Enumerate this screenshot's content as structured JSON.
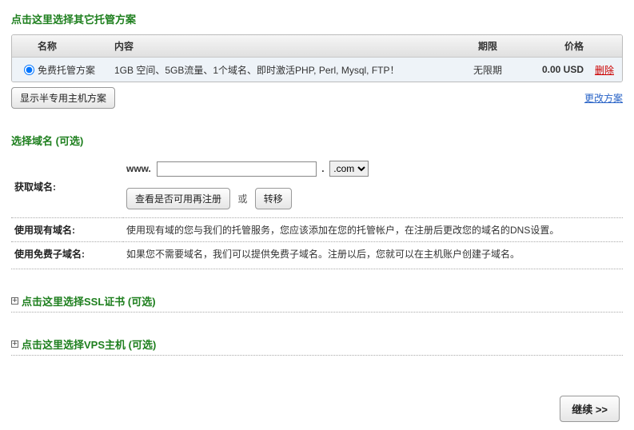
{
  "plans": {
    "section_title": "点击这里选择其它托管方案",
    "headers": {
      "name": "名称",
      "content": "内容",
      "term": "期限",
      "price": "价格"
    },
    "row": {
      "name": "免费托管方案",
      "content": "1GB 空间、5GB流量、1个域名、即时激活PHP, Perl, Mysql, FTP！",
      "term": "无限期",
      "price": "0.00 USD",
      "delete": "删除"
    },
    "show_semi": "显示半专用主机方案",
    "change_plan": "更改方案"
  },
  "domains": {
    "section_title": "选择域名 (可选)",
    "get_label": "获取域名:",
    "www": "www.",
    "tld": ".com",
    "check": "查看是否可用再注册",
    "or": "或",
    "transfer": "转移",
    "existing_label": "使用现有域名:",
    "existing_desc": "使用现有域的您与我们的托管服务，您应该添加在您的托管帐户，在注册后更改您的域名的DNS设置。",
    "freesub_label": "使用免费子域名:",
    "freesub_desc": "如果您不需要域名，我们可以提供免费子域名。注册以后，您就可以在主机账户创建子域名。"
  },
  "ssl": {
    "title": "点击这里选择SSL证书 (可选)"
  },
  "vps": {
    "title": "点击这里选择VPS主机 (可选)"
  },
  "continue": "继续 >>"
}
